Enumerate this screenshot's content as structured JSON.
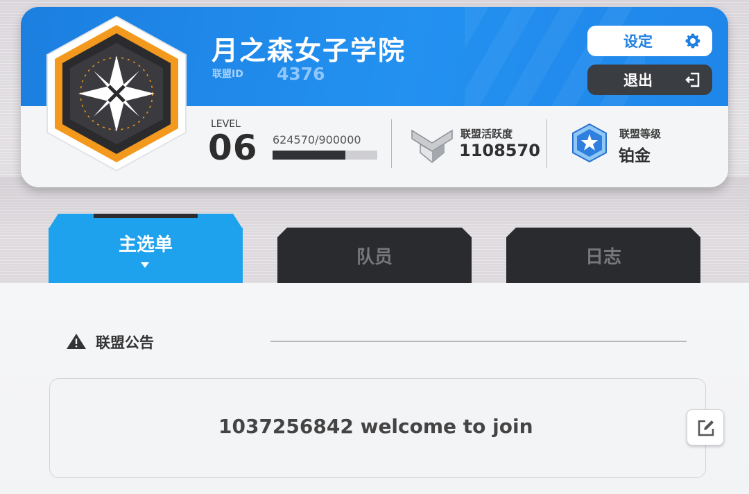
{
  "guild": {
    "name": "月之森女子学院",
    "id_label": "联盟ID",
    "id_value": "4376"
  },
  "buttons": {
    "settings": "设定",
    "exit": "退出"
  },
  "level": {
    "label": "LEVEL",
    "value": "06",
    "xp_text": "624570/900000",
    "xp_current": 624570,
    "xp_max": 900000
  },
  "activity": {
    "label": "联盟活跃度",
    "value": "1108570"
  },
  "rank": {
    "label": "联盟等级",
    "value": "铂金"
  },
  "tabs": {
    "main": "主选单",
    "members": "队员",
    "log": "日志",
    "active": "main"
  },
  "announcement": {
    "title": "联盟公告",
    "text": "1037256842 welcome to join"
  },
  "icons": {
    "settings": "gear-icon",
    "exit": "exit-door-icon",
    "activity": "silver-chevron-badge-icon",
    "rank": "blue-star-hexagon-icon",
    "emblem": "guild-emblem-hexagon",
    "warning": "warning-triangle-icon",
    "edit": "edit-pencil-icon"
  },
  "colors": {
    "primary_blue": "#1f86ea",
    "tab_active": "#1fa2ee",
    "tab_inactive": "#2a2b2f",
    "emblem_orange": "#f39a1e"
  }
}
